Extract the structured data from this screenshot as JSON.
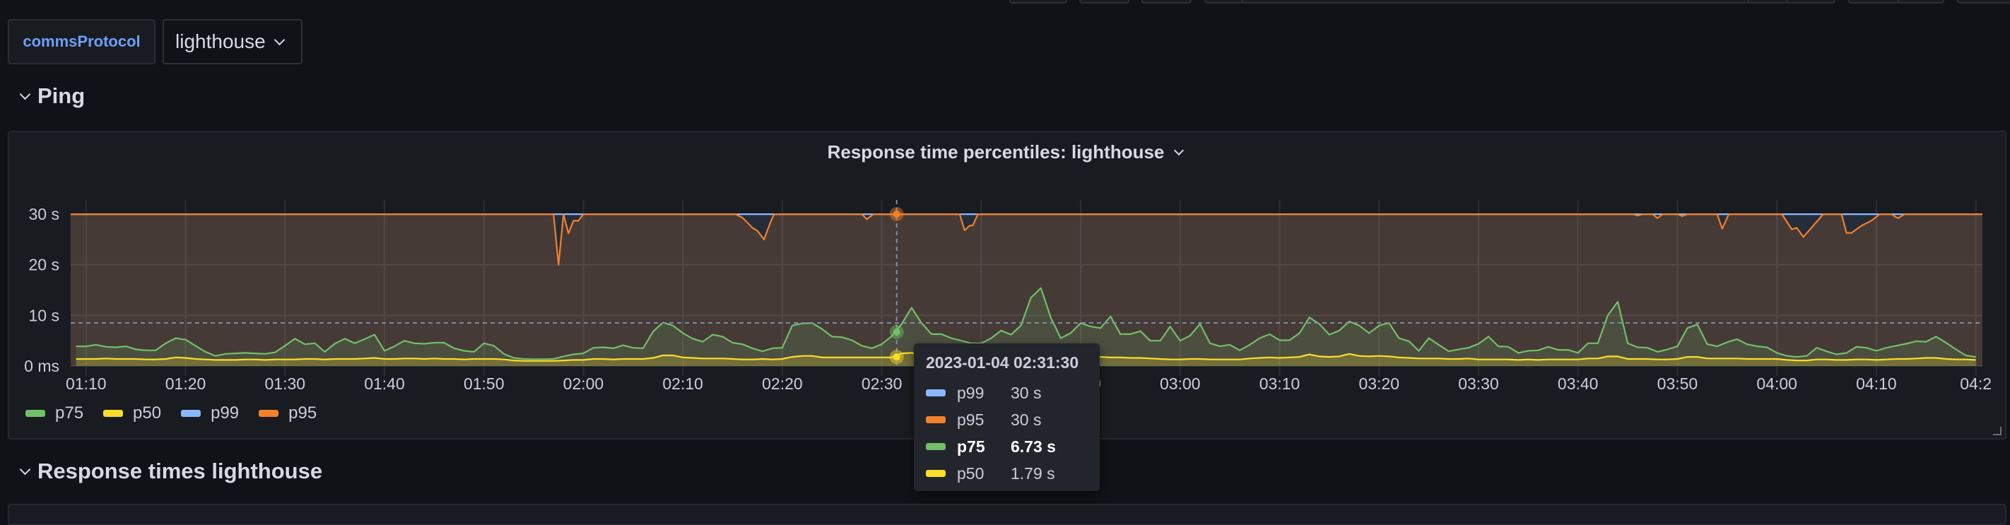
{
  "variables": {
    "label": "commsProtocol",
    "selected": "lighthouse"
  },
  "rows": [
    {
      "title": "Ping"
    },
    {
      "title": "Response times lighthouse"
    }
  ],
  "panel": {
    "title": "Response time percentiles: lighthouse"
  },
  "colors": {
    "p75": "#73bf69",
    "p50": "#fade2a",
    "p99": "#8ab8ff",
    "p95": "#f2812b",
    "accent": "#6e9fff",
    "background": "#111217",
    "panel": "#181b1f"
  },
  "legend": [
    {
      "name": "p75",
      "color": "#73bf69"
    },
    {
      "name": "p50",
      "color": "#fade2a"
    },
    {
      "name": "p99",
      "color": "#8ab8ff"
    },
    {
      "name": "p95",
      "color": "#f2812b"
    }
  ],
  "tooltip": {
    "time": "2023-01-04 02:31:30",
    "rows": [
      {
        "name": "p99",
        "value": "30 s",
        "color": "#8ab8ff"
      },
      {
        "name": "p95",
        "value": "30 s",
        "color": "#f2812b"
      },
      {
        "name": "p75",
        "value": "6.73 s",
        "color": "#73bf69",
        "highlighted": true
      },
      {
        "name": "p50",
        "value": "1.79 s",
        "color": "#fade2a"
      }
    ]
  },
  "chart_data": {
    "type": "line",
    "title": "Response time percentiles: lighthouse",
    "xlim": [
      "01:08:27",
      "04:20:40"
    ],
    "ylim": [
      0,
      32.8
    ],
    "grid": true,
    "legend_position": "bottom-left",
    "x_ticks": [
      "01:10",
      "01:20",
      "01:30",
      "01:40",
      "01:50",
      "02:00",
      "02:10",
      "02:20",
      "02:30",
      "02:40",
      "02:50",
      "03:00",
      "03:10",
      "03:20",
      "03:30",
      "03:40",
      "03:50",
      "04:00",
      "04:10",
      "04:2"
    ],
    "y_ticks": [
      {
        "value": 30,
        "label": "30 s"
      },
      {
        "value": 20,
        "label": "20 s"
      },
      {
        "value": 10,
        "label": "10 s"
      },
      {
        "value": 0,
        "label": "0 ms"
      }
    ],
    "hover": {
      "time": "02:31:30",
      "p95": 30,
      "p75": 6.73,
      "p50": 1.79
    },
    "x_start": "01:09",
    "x_step_minutes": 1,
    "series": [
      {
        "name": "p99",
        "color": "#8ab8ff",
        "points": [
          [
            "01:08:27",
            30
          ],
          [
            "04:20:40",
            30
          ]
        ]
      },
      {
        "name": "p95",
        "color": "#f2812b",
        "points": [
          [
            "01:08:27",
            30
          ],
          [
            "01:57:00",
            30
          ],
          [
            "01:57:30",
            20
          ],
          [
            "01:58:00",
            30
          ],
          [
            "01:58:30",
            26.2
          ],
          [
            "01:59:00",
            28.7
          ],
          [
            "01:59:30",
            28.7
          ],
          [
            "02:00:00",
            30
          ],
          [
            "02:15:20",
            30
          ],
          [
            "02:16:00",
            29.3
          ],
          [
            "02:17:00",
            27.3
          ],
          [
            "02:17:30",
            26.7
          ],
          [
            "02:18:10",
            25
          ],
          [
            "02:18:50",
            28.5
          ],
          [
            "02:19:10",
            30
          ],
          [
            "02:28:00",
            30
          ],
          [
            "02:28:30",
            29
          ],
          [
            "02:29:10",
            30
          ],
          [
            "02:37:50",
            30
          ],
          [
            "02:38:20",
            26.8
          ],
          [
            "02:38:50",
            27.7
          ],
          [
            "02:39:10",
            27.8
          ],
          [
            "02:39:40",
            30
          ],
          [
            "03:45:30",
            30
          ],
          [
            "03:46:00",
            29.7
          ],
          [
            "03:46:30",
            30
          ],
          [
            "03:47:30",
            30
          ],
          [
            "03:48:00",
            29.2
          ],
          [
            "03:48:30",
            30
          ],
          [
            "03:50:00",
            30
          ],
          [
            "03:50:30",
            29.6
          ],
          [
            "03:51:00",
            30
          ],
          [
            "03:54:00",
            30
          ],
          [
            "03:54:30",
            27.1
          ],
          [
            "03:55:10",
            30
          ],
          [
            "04:00:30",
            30
          ],
          [
            "04:01:30",
            27.0
          ],
          [
            "04:02:00",
            27.3
          ],
          [
            "04:02:40",
            25.5
          ],
          [
            "04:04:40",
            30
          ],
          [
            "04:06:30",
            30
          ],
          [
            "04:07:00",
            26.3
          ],
          [
            "04:07:30",
            26.3
          ],
          [
            "04:08:30",
            27.7
          ],
          [
            "04:09:30",
            28.7
          ],
          [
            "04:10:20",
            30
          ],
          [
            "04:11:30",
            30
          ],
          [
            "04:12:10",
            29.2
          ],
          [
            "04:12:50",
            30
          ],
          [
            "04:20:40",
            30
          ]
        ]
      },
      {
        "name": "p75",
        "color": "#73bf69",
        "values": [
          3.9,
          3.9,
          4.2,
          3.8,
          3.7,
          3.9,
          3.3,
          3.1,
          3.1,
          4.5,
          5.5,
          5.2,
          4.0,
          2.8,
          2.0,
          2.4,
          2.5,
          2.6,
          2.5,
          2.4,
          2.7,
          4.0,
          5.4,
          4.3,
          4.5,
          2.8,
          4.4,
          5.4,
          4.5,
          5.3,
          6.2,
          3.0,
          3.9,
          5.0,
          4.5,
          4.4,
          4.6,
          4.6,
          3.5,
          3.0,
          2.8,
          4.5,
          4.0,
          2.4,
          1.6,
          1.4,
          1.35,
          1.35,
          1.4,
          1.9,
          2.3,
          2.5,
          3.6,
          3.7,
          3.5,
          4.1,
          3.6,
          3.5,
          6.8,
          8.6,
          8.0,
          6.5,
          5.4,
          4.8,
          6.2,
          5.8,
          4.6,
          4.3,
          3.5,
          2.9,
          3.5,
          3.6,
          8.0,
          8.4,
          8.5,
          7.3,
          5.8,
          5.7,
          5.1,
          4.0,
          3.5,
          4.3,
          5.9,
          8.3,
          11.5,
          8.5,
          6.3,
          6.3,
          5.5,
          5.0,
          4.5,
          4.5,
          5.5,
          7.0,
          6.2,
          8.0,
          13.5,
          15.4,
          9.5,
          5.5,
          6.5,
          8.5,
          7.8,
          7.5,
          9.8,
          6.3,
          6.3,
          6.9,
          5.0,
          5.0,
          7.8,
          5.0,
          6.0,
          8.3,
          4.5,
          3.9,
          4.2,
          3.1,
          4.2,
          5.5,
          6.3,
          5.1,
          5.1,
          6.5,
          9.6,
          8.3,
          6.2,
          7.0,
          8.8,
          8.0,
          6.5,
          8.0,
          8.5,
          5.5,
          4.9,
          3.0,
          5.5,
          4.2,
          2.9,
          3.3,
          3.6,
          4.4,
          5.8,
          3.9,
          3.8,
          2.6,
          3.0,
          3.1,
          3.8,
          3.2,
          3.2,
          2.6,
          4.5,
          4.5,
          10.0,
          12.7,
          4.5,
          3.7,
          3.6,
          2.8,
          3.3,
          3.9,
          7.5,
          8.2,
          4.3,
          3.9,
          4.7,
          5.3,
          4.3,
          3.9,
          3.7,
          2.6,
          2.0,
          1.8,
          2.0,
          3.6,
          2.9,
          2.3,
          2.6,
          3.8,
          3.6,
          3.0,
          3.6,
          4.0,
          4.4,
          4.9,
          4.8,
          5.8,
          4.6,
          3.3,
          2.1,
          1.8
        ]
      },
      {
        "name": "p50",
        "color": "#fade2a",
        "values": [
          1.4,
          1.4,
          1.4,
          1.5,
          1.4,
          1.4,
          1.4,
          1.3,
          1.3,
          1.4,
          1.7,
          1.6,
          1.4,
          1.3,
          1.2,
          1.2,
          1.2,
          1.3,
          1.3,
          1.2,
          1.3,
          1.3,
          1.3,
          1.4,
          1.4,
          1.3,
          1.4,
          1.4,
          1.4,
          1.5,
          1.6,
          1.4,
          1.4,
          1.5,
          1.5,
          1.4,
          1.5,
          1.4,
          1.4,
          1.3,
          1.4,
          1.4,
          1.4,
          1.3,
          1.1,
          1.0,
          1.0,
          1.0,
          1.0,
          1.1,
          1.2,
          1.2,
          1.4,
          1.4,
          1.3,
          1.4,
          1.4,
          1.4,
          1.6,
          2.1,
          2.1,
          1.7,
          1.6,
          1.5,
          1.5,
          1.5,
          1.4,
          1.3,
          1.3,
          1.4,
          1.3,
          1.4,
          1.8,
          2.0,
          2.0,
          1.7,
          1.7,
          1.7,
          1.7,
          1.7,
          1.7,
          1.7,
          1.7,
          2.5,
          2.6,
          2.3,
          2.2,
          2.2,
          2.1,
          2.0,
          2.0,
          2.0,
          2.0,
          2.1,
          2.2,
          2.3,
          2.6,
          2.6,
          2.2,
          2.0,
          1.9,
          1.8,
          1.8,
          1.8,
          1.7,
          1.7,
          1.6,
          1.6,
          1.5,
          1.4,
          1.3,
          1.3,
          1.4,
          1.4,
          1.3,
          1.3,
          1.3,
          1.3,
          1.5,
          1.6,
          1.7,
          1.6,
          1.7,
          1.8,
          2.3,
          1.9,
          1.8,
          1.9,
          2.4,
          2.0,
          1.9,
          2.0,
          1.9,
          1.7,
          1.6,
          1.5,
          1.5,
          1.5,
          1.4,
          1.4,
          1.5,
          1.3,
          1.3,
          1.3,
          1.3,
          1.2,
          1.3,
          1.2,
          1.3,
          1.3,
          1.3,
          1.3,
          1.5,
          1.5,
          1.9,
          1.9,
          1.4,
          1.4,
          1.4,
          1.3,
          1.3,
          1.4,
          1.8,
          1.8,
          1.5,
          1.5,
          1.5,
          1.5,
          1.4,
          1.4,
          1.4,
          1.4,
          1.2,
          1.1,
          1.1,
          1.3,
          1.3,
          1.2,
          1.2,
          1.3,
          1.3,
          1.2,
          1.3,
          1.4,
          1.4,
          1.5,
          1.6,
          1.6,
          1.4,
          1.3,
          1.3,
          1.2
        ]
      }
    ]
  }
}
